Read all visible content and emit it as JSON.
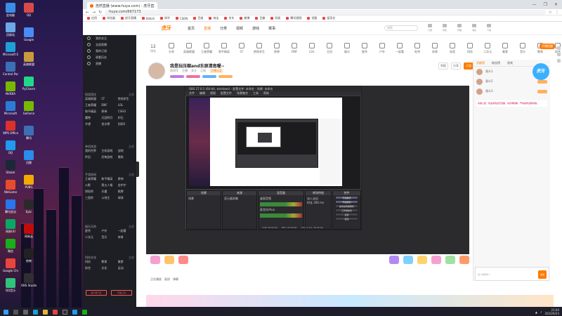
{
  "desktop_icons": [
    {
      "label": "此电脑",
      "color": "#3a8ee6"
    },
    {
      "label": "回收站",
      "color": "#6aa8e8"
    },
    {
      "label": "Microsoft Edge",
      "color": "#1f9fd8"
    },
    {
      "label": "Control Panel",
      "color": "#3c6fb5"
    },
    {
      "label": "NVIDIA",
      "color": "#76b900"
    },
    {
      "label": "Microsoft",
      "color": "#2b7cd3"
    },
    {
      "label": "WPS Office",
      "color": "#d9312b"
    },
    {
      "label": "QQ",
      "color": "#1e9bf0"
    },
    {
      "label": "Steam",
      "color": "#1b2838"
    },
    {
      "label": "WeGame",
      "color": "#e84a2e"
    },
    {
      "label": "腾讯会议",
      "color": "#2776ed"
    },
    {
      "label": "网易UU",
      "color": "#0aa864"
    },
    {
      "label": "微信",
      "color": "#1aad19"
    },
    {
      "label": "Google Chrome",
      "color": "#e8453c"
    },
    {
      "label": "QQ音乐",
      "color": "#31c27c"
    }
  ],
  "desktop_icons_col2": [
    {
      "label": "QQ",
      "color": "#d84a4a"
    },
    {
      "label": "Google",
      "color": "#4a8bf5"
    },
    {
      "label": "英雄联盟",
      "color": "#c89b3c"
    },
    {
      "label": "PyCharm",
      "color": "#21d789"
    },
    {
      "label": "GeForce",
      "color": "#76b900"
    },
    {
      "label": "腾讯",
      "color": "#3c6fb5"
    },
    {
      "label": "迅雷",
      "color": "#2a8ceb"
    },
    {
      "label": "PUBG",
      "color": "#f2a900"
    },
    {
      "label": "Epic",
      "color": "#2a2a2a"
    },
    {
      "label": "网易云",
      "color": "#c20c0c"
    },
    {
      "label": "剪映",
      "color": "#222222"
    },
    {
      "label": "OBS Studio",
      "color": "#302e31"
    }
  ],
  "browser": {
    "tab_title": "浩然直播 (www.huya.com) - 虎牙直播",
    "url": "huya.com/667173",
    "window_controls": [
      "—",
      "❐",
      "✕"
    ],
    "bookmarks": [
      "应用",
      "浏览器",
      "虎牙直播",
      "Bilibili",
      "知乎",
      "CSDN",
      "百度",
      "淘宝",
      "京东",
      "微博",
      "豆瓣",
      "网易",
      "腾讯视频",
      "优酷",
      "爱奇艺"
    ]
  },
  "huya": {
    "logo": "虎牙",
    "nav": [
      "首页",
      "直播",
      "分类",
      "视频",
      "游戏",
      "赛事"
    ],
    "active_nav": "直播",
    "search_placeholder": "搜索",
    "header_icons": [
      "订阅",
      "历史",
      "开播",
      "消息",
      "下载"
    ],
    "rank_label": "12",
    "rank_sub": "排名",
    "hot_badge": "开播提醒",
    "categories": [
      "分享",
      "英雄联盟",
      "王者荣耀",
      "和平精英",
      "CF",
      "绝地求生",
      "原神",
      "DNF",
      "LOL",
      "主机",
      "娱乐",
      "星秀",
      "户外",
      "一起看",
      "吃鸡",
      "体育",
      "电竞",
      "科技",
      "二次元",
      "美食",
      "音乐",
      "教育",
      "综合"
    ],
    "room": {
      "title": "我是玩压缩and东原清南喔~",
      "info": [
        "房间号",
        "主播",
        "关注",
        "订阅"
      ],
      "tag": "主播认证",
      "follow": "订阅",
      "actions": [
        "举报",
        "分享"
      ]
    }
  },
  "sidebar": {
    "top": [
      "我的关注",
      "全部直播",
      "我的订阅",
      "观看历史",
      "直播"
    ],
    "sections": [
      {
        "title": "网游竞技",
        "more": "全部",
        "items": [
          "英雄联盟",
          "CF",
          "绝地求生",
          "王者荣耀",
          "DNF",
          "LOL",
          "和平精英",
          "原神",
          "CSGO",
          "魔兽",
          "天涯明月",
          "炉石",
          "守望",
          "逆水寒",
          "剑网3"
        ]
      },
      {
        "title": "单机热游",
        "more": "全部",
        "items": [
          "我的世界",
          "主机游戏",
          "战地",
          "怀旧",
          "恐怖游戏",
          "模拟"
        ]
      },
      {
        "title": "手游休闲",
        "more": "全部",
        "items": [
          "王者荣耀",
          "和平精英",
          "原神",
          "火影",
          "第五人格",
          "金铲铲",
          "阴阳师",
          "光遇",
          "棋牌",
          "三国杀",
          "斗地主",
          "球球"
        ]
      },
      {
        "title": "娱乐天地",
        "more": "全部",
        "items": [
          "星秀",
          "户外",
          "一起看",
          "二次元",
          "音乐",
          "体育"
        ]
      },
      {
        "title": "科技文化",
        "more": "全部",
        "items": [
          "科技",
          "教育",
          "美食",
          "综合",
          "文化",
          "运动"
        ]
      }
    ],
    "footer": [
      "客户端下载",
      "开播工具"
    ]
  },
  "obs": {
    "title": "OBS 27.0.1 (64-bit, windows) - 配置文件: 未命名 - 场景: 未命名",
    "menu": [
      "文件",
      "编辑",
      "视图",
      "配置文件",
      "场景集合",
      "工具",
      "帮助"
    ],
    "docks": [
      {
        "title": "场景",
        "items": [
          "场景"
        ]
      },
      {
        "title": "来源",
        "items": [
          "显示器采集"
        ]
      },
      {
        "title": "混音器",
        "items": [
          "桌面音频",
          "麦克风/Aux"
        ]
      },
      {
        "title": "转场特效",
        "items": [
          "淡入淡出",
          "时长 300 ms"
        ]
      },
      {
        "title": "控件",
        "items": []
      }
    ],
    "controls": [
      "开始推流",
      "开始录制",
      "启动虚拟摄像机",
      "工作室模式",
      "设置",
      "退出"
    ],
    "status": [
      "LIVE: 00:00:00",
      "REC: 00:00:00",
      "CPU: 4.1%, 30.00 fps"
    ]
  },
  "right_panel": {
    "tabs": [
      "贡献榜",
      "粉丝榜",
      "贵宾"
    ],
    "active_tab": "贡献榜",
    "ranks": [
      "观众1",
      "观众2",
      "观众3"
    ],
    "notice": "系统公告：欢迎来到虎牙直播，请文明观看，严禁发布违规内容。",
    "input_placeholder": "发个弹幕吧～",
    "send": "发送"
  },
  "float_logo": "虎牙",
  "vbar": [
    "正在播放",
    "画质",
    "弹幕"
  ],
  "taskbar_icons": [
    "开始",
    "搜索",
    "任务视图",
    "Edge",
    "文件",
    "Chrome",
    "OBS",
    "QQ",
    "微信"
  ],
  "tray": {
    "time": "21:04",
    "date": "2022/6/24"
  }
}
